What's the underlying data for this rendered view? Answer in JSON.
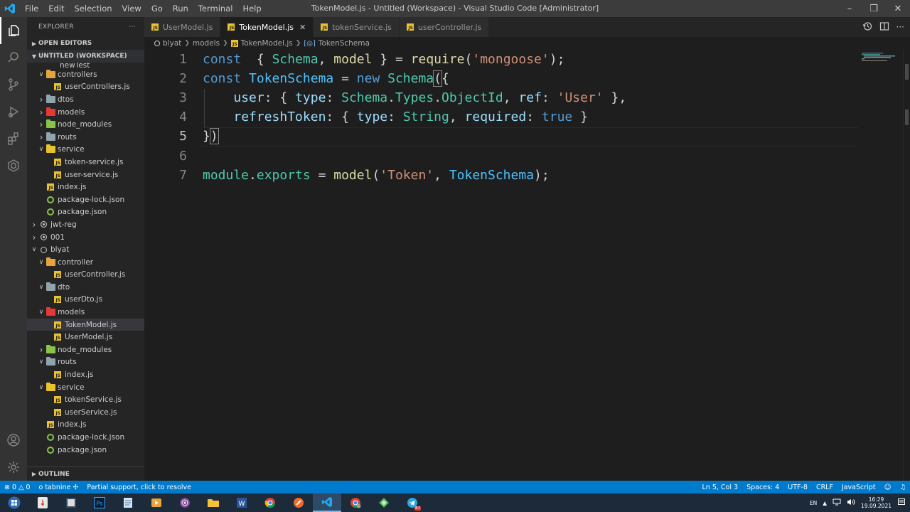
{
  "titlebar": {
    "menu": [
      "File",
      "Edit",
      "Selection",
      "View",
      "Go",
      "Run",
      "Terminal",
      "Help"
    ],
    "title": "TokenModel.js - Untitled (Workspace) - Visual Studio Code [Administrator]"
  },
  "sidebar": {
    "header": "EXPLORER",
    "open_editors": "OPEN EDITORS",
    "workspace": "UNTITLED (WORKSPACE)",
    "clipped_item": "newTest",
    "tree": [
      {
        "label": "controllers",
        "kind": "folder",
        "color": "#e8a33c",
        "depth": 1,
        "open": true
      },
      {
        "label": "userControllers.js",
        "kind": "js",
        "depth": 2
      },
      {
        "label": "dtos",
        "kind": "folder",
        "color": "#90a4ae",
        "depth": 1,
        "open": false
      },
      {
        "label": "models",
        "kind": "folder",
        "color": "#e53935",
        "depth": 1,
        "open": false
      },
      {
        "label": "node_modules",
        "kind": "folder",
        "color": "#8bc34a",
        "depth": 1,
        "open": false
      },
      {
        "label": "routs",
        "kind": "folder",
        "color": "#90a4ae",
        "depth": 1,
        "open": false
      },
      {
        "label": "service",
        "kind": "folder",
        "color": "#e8c22f",
        "depth": 1,
        "open": true
      },
      {
        "label": "token-service.js",
        "kind": "js",
        "depth": 2
      },
      {
        "label": "user-service.js",
        "kind": "js",
        "depth": 2
      },
      {
        "label": "index.js",
        "kind": "js",
        "depth": 1
      },
      {
        "label": "package-lock.json",
        "kind": "json",
        "depth": 1
      },
      {
        "label": "package.json",
        "kind": "json",
        "depth": 1
      },
      {
        "label": "jwt-reg",
        "kind": "root",
        "depth": 0,
        "open": false,
        "filled": true
      },
      {
        "label": "001",
        "kind": "root",
        "depth": 0,
        "open": false,
        "filled": true
      },
      {
        "label": "blyat",
        "kind": "root",
        "depth": 0,
        "open": true,
        "filled": false
      },
      {
        "label": "controller",
        "kind": "folder",
        "color": "#e8a33c",
        "depth": 1,
        "open": true
      },
      {
        "label": "userController.js",
        "kind": "js",
        "depth": 2
      },
      {
        "label": "dto",
        "kind": "folder",
        "color": "#90a4ae",
        "depth": 1,
        "open": true
      },
      {
        "label": "userDto.js",
        "kind": "js",
        "depth": 2
      },
      {
        "label": "models",
        "kind": "folder",
        "color": "#e53935",
        "depth": 1,
        "open": true
      },
      {
        "label": "TokenModel.js",
        "kind": "js",
        "depth": 2,
        "selected": true
      },
      {
        "label": "UserModel.js",
        "kind": "js",
        "depth": 2
      },
      {
        "label": "node_modules",
        "kind": "folder",
        "color": "#8bc34a",
        "depth": 1,
        "open": false
      },
      {
        "label": "routs",
        "kind": "folder",
        "color": "#90a4ae",
        "depth": 1,
        "open": true
      },
      {
        "label": "index.js",
        "kind": "js",
        "depth": 2
      },
      {
        "label": "service",
        "kind": "folder",
        "color": "#e8c22f",
        "depth": 1,
        "open": true
      },
      {
        "label": "tokenService.js",
        "kind": "js",
        "depth": 2
      },
      {
        "label": "userService.js",
        "kind": "js",
        "depth": 2
      },
      {
        "label": "index.js",
        "kind": "js",
        "depth": 1
      },
      {
        "label": "package-lock.json",
        "kind": "json",
        "depth": 1
      },
      {
        "label": "package.json",
        "kind": "json",
        "depth": 1
      }
    ],
    "outline": "OUTLINE"
  },
  "tabs": [
    {
      "label": "UserModel.js",
      "active": false
    },
    {
      "label": "TokenModel.js",
      "active": true
    },
    {
      "label": "tokenService.js",
      "active": false
    },
    {
      "label": "userController.js",
      "active": false
    }
  ],
  "breadcrumb": [
    "blyat",
    "models",
    "TokenModel.js",
    "TokenSchema"
  ],
  "editor": {
    "line_numbers": [
      "1",
      "2",
      "3",
      "4",
      "5",
      "6",
      "7"
    ],
    "lines": [
      [
        [
          "kw",
          "const"
        ],
        [
          "",
          "  "
        ],
        [
          "",
          "{ "
        ],
        [
          "cls",
          "Schema"
        ],
        [
          "",
          ", "
        ],
        [
          "fn",
          "model"
        ],
        [
          "",
          " } = "
        ],
        [
          "fn",
          "require"
        ],
        [
          "",
          "("
        ],
        [
          "str",
          "'mongoose'"
        ],
        [
          "",
          ");"
        ]
      ],
      [
        [
          "kw",
          "const"
        ],
        [
          "",
          " "
        ],
        [
          "var",
          "TokenSchema"
        ],
        [
          "",
          " = "
        ],
        [
          "kw",
          "new"
        ],
        [
          "",
          " "
        ],
        [
          "cls",
          "Schema"
        ],
        [
          "bracket",
          "("
        ],
        [
          "",
          "{"
        ]
      ],
      [
        [
          "",
          "    "
        ],
        [
          "prop",
          "user"
        ],
        [
          "",
          ": { "
        ],
        [
          "prop",
          "type"
        ],
        [
          "",
          ": "
        ],
        [
          "cls",
          "Schema"
        ],
        [
          "",
          "."
        ],
        [
          "cls",
          "Types"
        ],
        [
          "",
          "."
        ],
        [
          "cls",
          "ObjectId"
        ],
        [
          "",
          ", "
        ],
        [
          "prop",
          "ref"
        ],
        [
          "",
          ": "
        ],
        [
          "str",
          "'User'"
        ],
        [
          "",
          " },"
        ]
      ],
      [
        [
          "",
          "    "
        ],
        [
          "prop",
          "refreshToken"
        ],
        [
          "",
          ": { "
        ],
        [
          "prop",
          "type"
        ],
        [
          "",
          ": "
        ],
        [
          "cls",
          "String"
        ],
        [
          "",
          ", "
        ],
        [
          "prop",
          "required"
        ],
        [
          "",
          ": "
        ],
        [
          "kw",
          "true"
        ],
        [
          "",
          " }"
        ]
      ],
      [
        [
          "",
          "}"
        ],
        [
          "bracket",
          ")"
        ]
      ],
      [],
      [
        [
          "cls",
          "module"
        ],
        [
          "",
          "."
        ],
        [
          "cls",
          "exports"
        ],
        [
          "",
          " = "
        ],
        [
          "fn",
          "model"
        ],
        [
          "",
          "("
        ],
        [
          "str",
          "'Token'"
        ],
        [
          "",
          ", "
        ],
        [
          "var",
          "TokenSchema"
        ],
        [
          "",
          ");"
        ]
      ]
    ]
  },
  "statusbar": {
    "errors": "0",
    "warnings": "0",
    "tabnine": "tabnine",
    "partial": "Partial support, click to resolve",
    "position": "Ln 5, Col 3",
    "spaces": "Spaces: 4",
    "encoding": "UTF-8",
    "eol": "CRLF",
    "language": "JavaScript"
  },
  "taskbar": {
    "lang": "EN",
    "time": "16:29",
    "date": "19.09.2021",
    "badge": "87"
  }
}
